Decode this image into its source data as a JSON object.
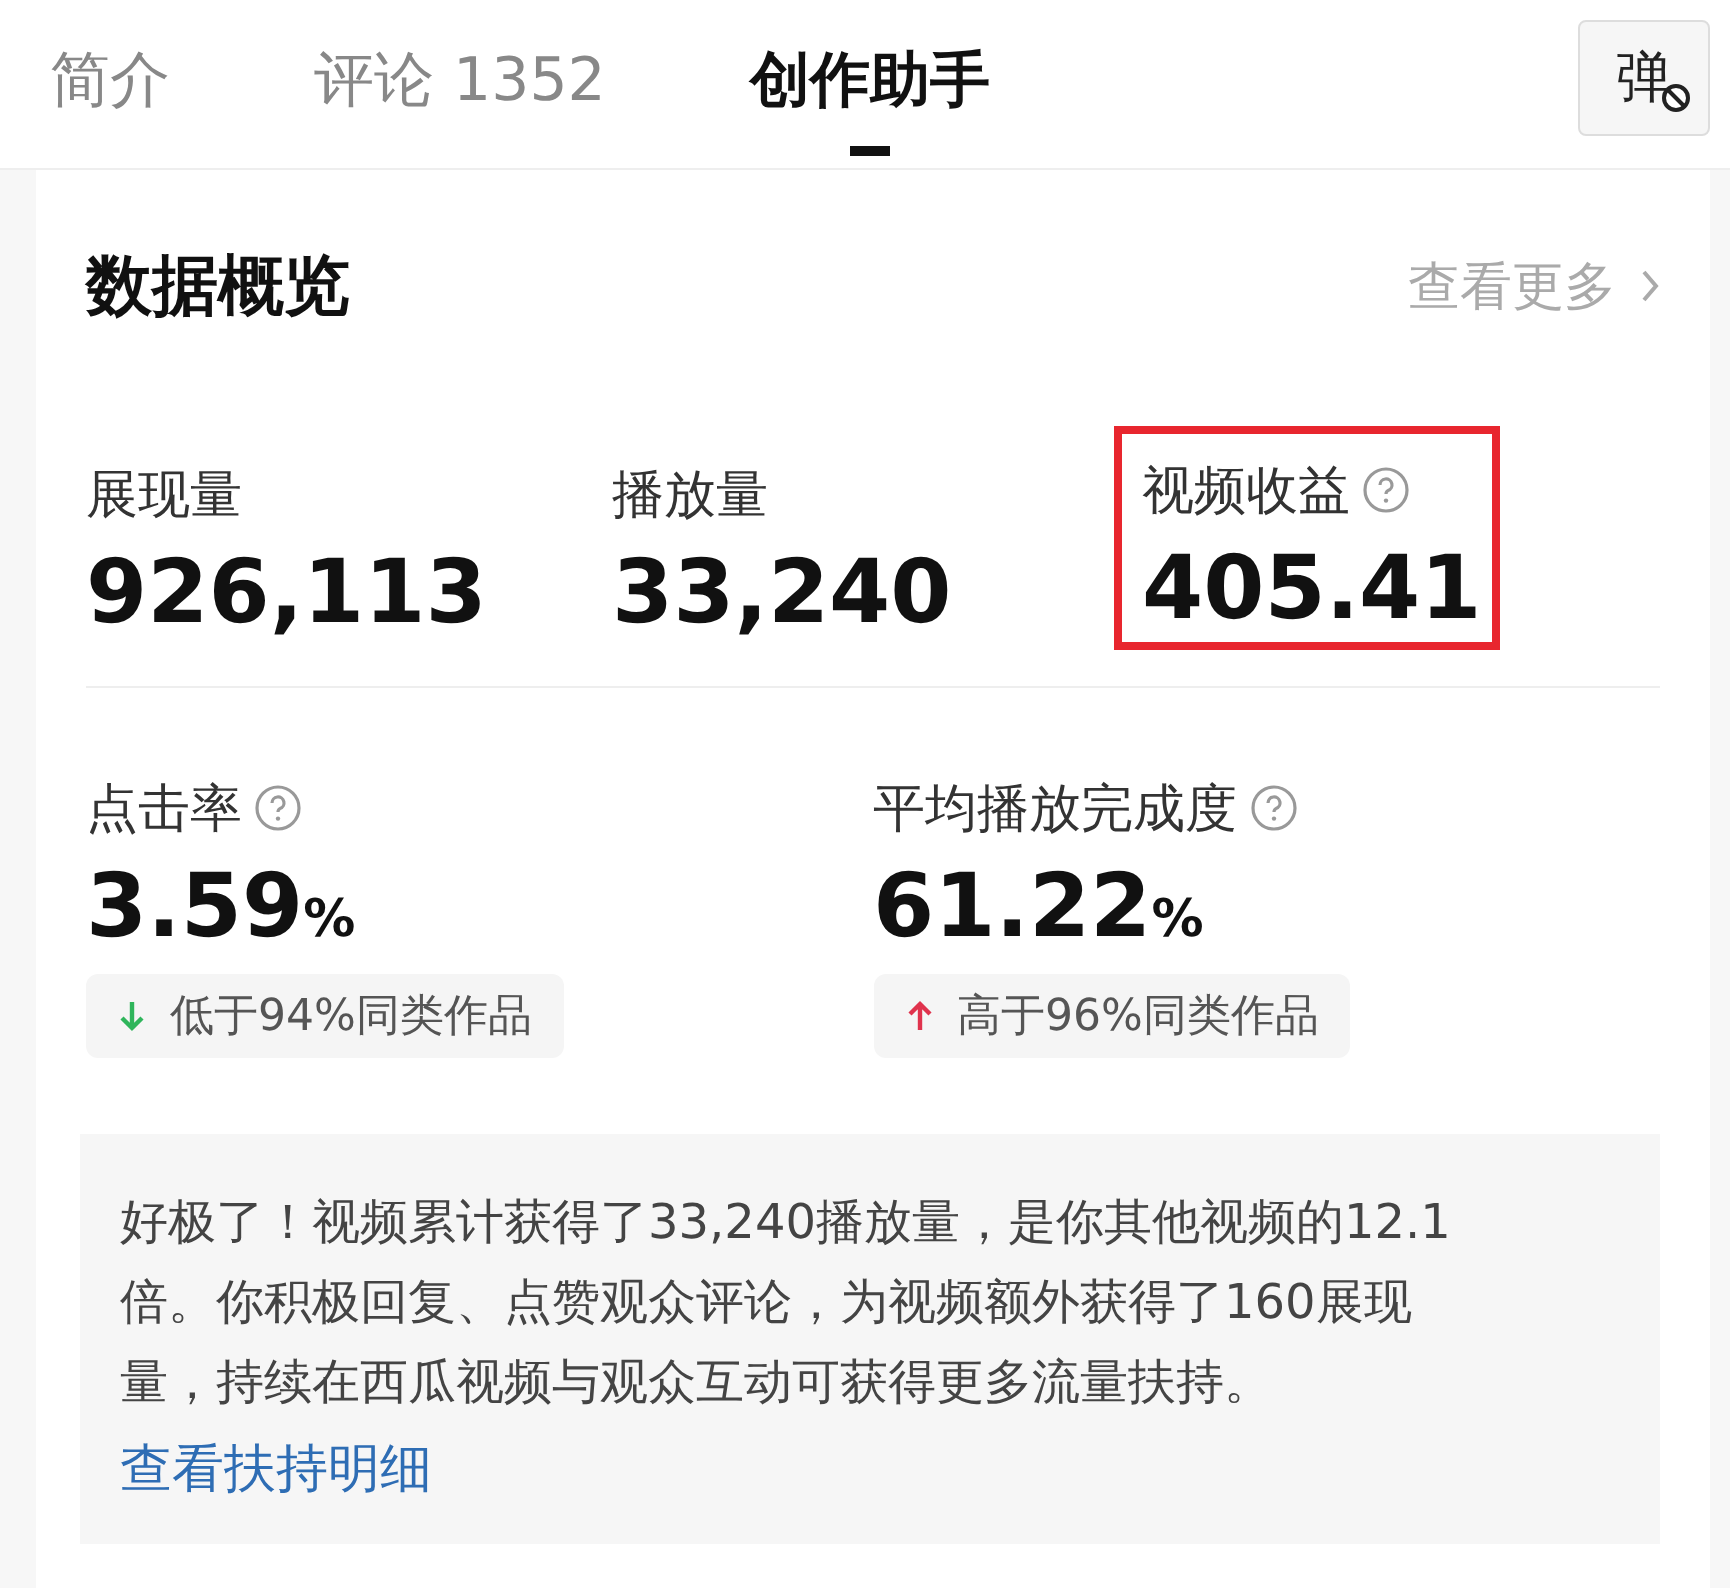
{
  "tabs": [
    {
      "label": "简介",
      "selected": false
    },
    {
      "label": "评论 1352",
      "selected": false
    },
    {
      "label": "创作助手",
      "selected": true
    }
  ],
  "danmaku_button": {
    "label": "弹",
    "on": false
  },
  "overview": {
    "title": "数据概览",
    "more_link": "查看更多",
    "top_metrics": [
      {
        "label": "展现量",
        "value": "926,113",
        "help": false,
        "highlighted": false
      },
      {
        "label": "播放量",
        "value": "33,240",
        "help": false,
        "highlighted": false
      },
      {
        "label": "视频收益",
        "value": "405.41",
        "help": true,
        "highlighted": true
      }
    ],
    "rate_metrics": [
      {
        "label": "点击率",
        "value": "3.59",
        "unit": "%",
        "comparison": {
          "kind": "down",
          "text": "低于94%同类作品"
        }
      },
      {
        "label": "平均播放完成度",
        "value": "61.22",
        "unit": "%",
        "comparison": {
          "kind": "up",
          "text": "高于96%同类作品"
        }
      }
    ],
    "summary": {
      "text": "好极了！视频累计获得了33,240播放量，是你其他视频的12.1倍。你积极回复、点赞观众评论，为视频额外获得了160展现量，持续在西瓜视频与观众互动可获得更多流量扶持。",
      "link": "查看扶持明细"
    }
  }
}
